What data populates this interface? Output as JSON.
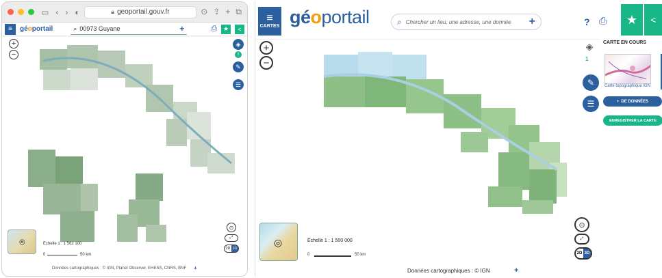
{
  "left": {
    "browser": {
      "url": "geoportail.gouv.fr"
    },
    "toolbar": {
      "logo": {
        "pre": "gé",
        "o": "o",
        "post": "portail"
      },
      "search_value": "00973 Guyane",
      "plus": "+"
    },
    "map": {
      "scale_text": "Echelle 1 : 1 562 100",
      "scale_zero": "0",
      "scale_km": "50 km",
      "credits": "Données cartographiques : © IGN, Planet Observer, EHESS, CNRS, BNF",
      "toggle_2d": "2D",
      "toggle_3d": "3D"
    }
  },
  "right": {
    "header": {
      "cartes_label": "CARTES",
      "logo": {
        "pre": "gé",
        "o": "o",
        "post": "portail"
      },
      "search_placeholder": "Chercher un lieu, une adresse, une donnée",
      "search_plus": "+",
      "help": "?"
    },
    "side": {
      "layers_count": "1"
    },
    "panel": {
      "title": "CARTE EN COURS",
      "thumb_label": "Carte topographique IGN",
      "add_data": "DE DONNÉES",
      "add_plus": "+",
      "save": "ENREGISTRER LA CARTE"
    },
    "map": {
      "scale_text": "Échelle 1 : 1 500 000",
      "scale_zero": "0",
      "scale_km": "50 km",
      "credits": "Données cartographiques : © IGN",
      "credits_plus": "+",
      "toggle_2d": "2D",
      "toggle_3d": "3D"
    }
  },
  "colors": {
    "brand_blue": "#2b5f9e",
    "brand_green": "#19b687",
    "logo_orange": "#f59e0b",
    "map_land": "#8fbf8a",
    "map_coast": "#a9cfe0"
  },
  "icons": {
    "menu": "hamburger-icon",
    "search": "search-icon",
    "print": "printer-icon",
    "star": "star-icon",
    "share": "share-icon",
    "layers": "layers-icon",
    "tools": "wrench-icon",
    "legend": "list-icon",
    "zoom_in": "plus-icon",
    "zoom_out": "minus-icon",
    "locate": "crosshair-icon",
    "fullscreen": "fullscreen-icon"
  }
}
